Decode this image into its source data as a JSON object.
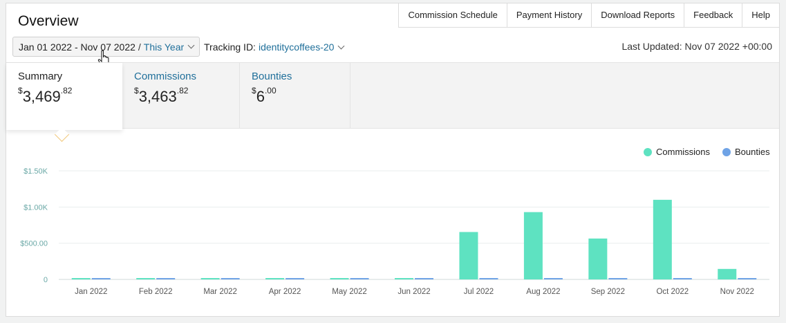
{
  "header": {
    "title": "Overview"
  },
  "topnav": [
    {
      "label": "Commission Schedule"
    },
    {
      "label": "Payment History"
    },
    {
      "label": "Download Reports"
    },
    {
      "label": "Feedback"
    },
    {
      "label": "Help"
    }
  ],
  "filters": {
    "date_range": "Jan 01 2022 - Nov 07 2022",
    "separator": "/",
    "period": "This Year",
    "tracking_label": "Tracking ID:",
    "tracking_id": "identitycoffees-20",
    "last_updated": "Last Updated: Nov 07 2022 +00:00"
  },
  "tabs": {
    "summary": {
      "label": "Summary",
      "currency": "$",
      "whole": "3,469",
      "cents": ".82"
    },
    "commissions": {
      "label": "Commissions",
      "currency": "$",
      "whole": "3,463",
      "cents": ".82"
    },
    "bounties": {
      "label": "Bounties",
      "currency": "$",
      "whole": "6",
      "cents": ".00"
    }
  },
  "legend": [
    {
      "label": "Commissions",
      "color": "#5ee2c1"
    },
    {
      "label": "Bounties",
      "color": "#6fa3e6"
    }
  ],
  "chart_data": {
    "type": "bar",
    "categories": [
      "Jan 2022",
      "Feb 2022",
      "Mar 2022",
      "Apr 2022",
      "May 2022",
      "Jun 2022",
      "Jul 2022",
      "Aug 2022",
      "Sep 2022",
      "Oct 2022",
      "Nov 2022"
    ],
    "series": [
      {
        "name": "Commissions",
        "color": "#5ee2c1",
        "values": [
          0,
          0,
          0,
          0,
          0,
          0,
          655,
          930,
          565,
          1100,
          145
        ]
      },
      {
        "name": "Bounties",
        "color": "#6fa3e6",
        "values": [
          0,
          0,
          0,
          0,
          0,
          0,
          0,
          0,
          0,
          0,
          0
        ]
      }
    ],
    "yticks": [
      {
        "value": 0,
        "label": "0"
      },
      {
        "value": 500,
        "label": "$500.00"
      },
      {
        "value": 1000,
        "label": "$1.00K"
      },
      {
        "value": 1500,
        "label": "$1.50K"
      }
    ],
    "ylim": [
      0,
      1500
    ],
    "grid": true,
    "legend": "top-right"
  }
}
